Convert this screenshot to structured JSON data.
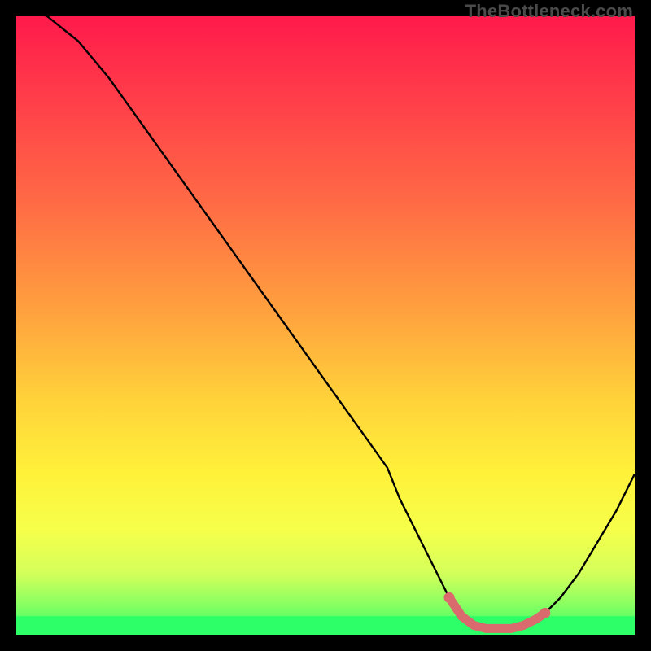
{
  "watermark": "TheBottleneck.com",
  "chart_data": {
    "type": "line",
    "title": "",
    "xlabel": "",
    "ylabel": "",
    "xlim": [
      0,
      100
    ],
    "ylim": [
      0,
      100
    ],
    "grid": false,
    "legend": false,
    "series": [
      {
        "name": "bottleneck-curve",
        "x": [
          0,
          5,
          10,
          15,
          20,
          25,
          30,
          35,
          40,
          45,
          50,
          55,
          60,
          62,
          65,
          68,
          70,
          72,
          74,
          76,
          78,
          80,
          82,
          85,
          88,
          91,
          94,
          97,
          100
        ],
        "values": [
          102,
          100,
          96,
          90,
          83,
          76,
          69,
          62,
          55,
          48,
          41,
          34,
          27,
          22,
          16,
          10,
          6,
          3,
          1.5,
          1,
          1,
          1,
          1.5,
          3,
          6,
          10,
          15,
          20,
          26
        ]
      },
      {
        "name": "highlighted-range",
        "x": [
          70,
          72,
          74,
          76,
          78,
          80,
          82,
          84,
          85.5
        ],
        "values": [
          6,
          3,
          1.5,
          1,
          1,
          1,
          1.5,
          2.5,
          3.5
        ]
      }
    ],
    "gradient_stops": [
      {
        "offset": 0.0,
        "color": "#ff1a4b"
      },
      {
        "offset": 0.12,
        "color": "#ff3a4a"
      },
      {
        "offset": 0.3,
        "color": "#ff6a45"
      },
      {
        "offset": 0.48,
        "color": "#ffa23e"
      },
      {
        "offset": 0.62,
        "color": "#ffd23a"
      },
      {
        "offset": 0.74,
        "color": "#fff13a"
      },
      {
        "offset": 0.83,
        "color": "#f6ff4a"
      },
      {
        "offset": 0.9,
        "color": "#d4ff5a"
      },
      {
        "offset": 0.95,
        "color": "#8bff61"
      },
      {
        "offset": 1.0,
        "color": "#2cff67"
      }
    ],
    "green_band": {
      "y": 0,
      "height": 3
    },
    "highlight_color": "#d96a6e",
    "curve_color": "#000000"
  }
}
